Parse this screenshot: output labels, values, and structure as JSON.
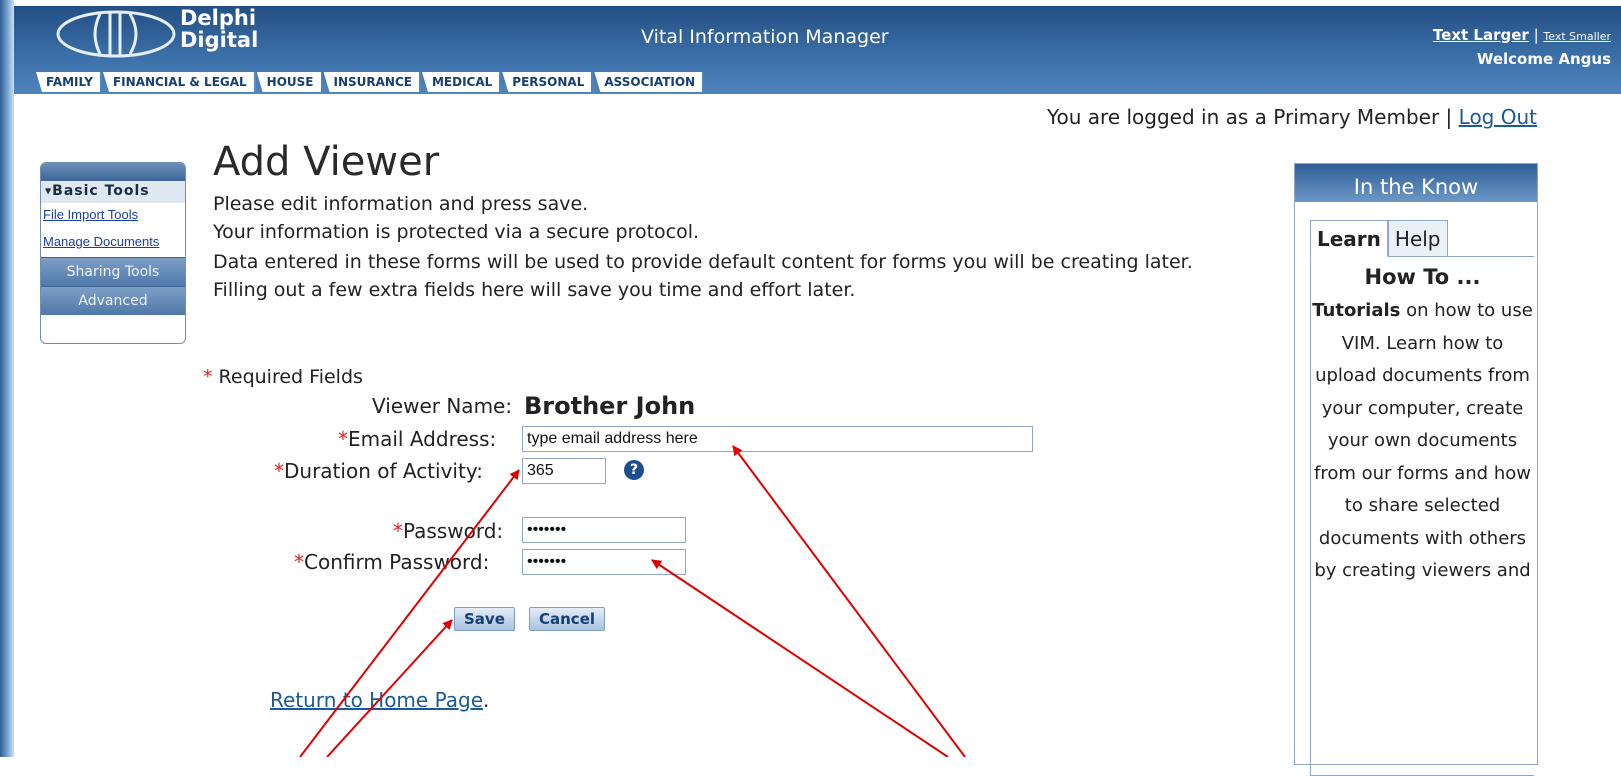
{
  "brand": {
    "line1": "Delphi",
    "line2": "Digital"
  },
  "header": {
    "app_title": "Vital Information Manager",
    "text_larger": "Text Larger",
    "separator": "|",
    "text_smaller": "Text Smaller",
    "welcome": "Welcome Angus"
  },
  "tabs": [
    "FAMILY",
    "FINANCIAL & LEGAL",
    "HOUSE",
    "INSURANCE",
    "MEDICAL",
    "PERSONAL",
    "ASSOCIATION"
  ],
  "login": {
    "text": "You are logged in as a Primary Member",
    "separator": "|",
    "logout": "Log Out"
  },
  "sidebar": {
    "title": "Basic Tools",
    "links": [
      "File Import Tools",
      "Manage Documents"
    ],
    "sections": [
      "Sharing Tools",
      "Advanced"
    ]
  },
  "page": {
    "title": "Add Viewer",
    "intro1": "Please edit information and press save.",
    "intro2": "Your information is protected via a secure protocol.",
    "intro3": "Data entered in these forms will be used to provide default content for forms you will be creating later.",
    "intro4": "Filling out a few extra fields here will save you time and effort later.",
    "required": "Required Fields"
  },
  "form": {
    "viewer_name_label": "Viewer Name:",
    "viewer_name": "Brother John",
    "email_label": "Email Address:",
    "email_value": "type email address here",
    "duration_label": "Duration of Activity:",
    "duration_value": "365",
    "password_label": "Password:",
    "password_value": "•••••••",
    "confirm_label": "Confirm Password:",
    "confirm_value": "•••••••",
    "help_glyph": "?",
    "save": "Save",
    "cancel": "Cancel"
  },
  "return": {
    "link": "Return to Home Page",
    "suffix": "."
  },
  "know": {
    "title": "In the Know",
    "tabs": [
      "Learn",
      "Help"
    ],
    "heading": "How To ...",
    "bold": "Tutorials",
    "text": " on how to use VIM. Learn how to upload documents from your computer, create your own documents from our forms and how to share selected documents with others by creating viewers and"
  },
  "colors": {
    "header": "#3a6ea6",
    "link": "#1a5a96",
    "required_star": "#dd2222",
    "annotation_arrow": "#e00000"
  }
}
